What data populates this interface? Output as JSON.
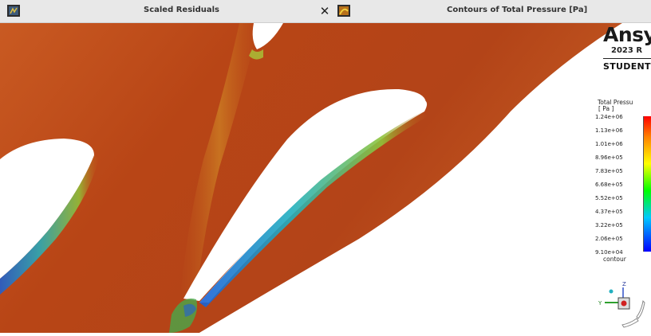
{
  "tabs": [
    {
      "title": "Scaled Residuals",
      "close_label": "✕",
      "icon": "fluent-window-icon"
    },
    {
      "title": "Contours of Total Pressure [Pa]",
      "icon": "fluent-window-icon"
    }
  ],
  "logo": {
    "brand": "Ansy",
    "version": "2023 R",
    "edition": "STUDENT"
  },
  "legend": {
    "title": "Total Pressu",
    "unit": "[ Pa ]",
    "ticks": [
      "1.24e+06",
      "1.13e+06",
      "1.01e+06",
      "8.96e+05",
      "7.83e+05",
      "6.68e+05",
      "5.52e+05",
      "4.37e+05",
      "3.22e+05",
      "2.06e+05",
      "9.10e+04"
    ],
    "footer": "contour",
    "colors": [
      "#ff0000",
      "#ff7f00",
      "#ffff00",
      "#00ff00",
      "#00c8ff",
      "#0000ff"
    ]
  },
  "contour": {
    "dominant_color": "#c0501c",
    "boundary_low_color": "#1f5fd8",
    "wake_color": "#8fbf3a"
  },
  "triad": {
    "y_label": "Y",
    "z_label": "Z"
  }
}
